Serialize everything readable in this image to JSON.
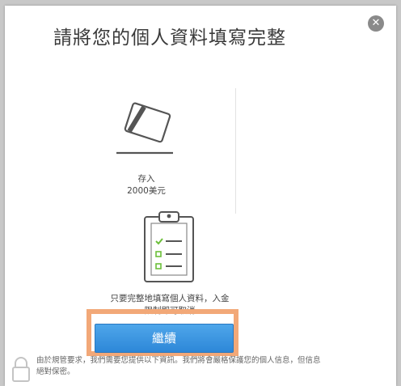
{
  "modal": {
    "title": "請將您的個人資料填寫完整",
    "close_symbol": "✕"
  },
  "deposit": {
    "label": "存入",
    "amount": "2000美元",
    "icon": "credit-card-icon"
  },
  "verification": {
    "icon": "clipboard-checklist-icon",
    "note_line1": "只要完整地填寫個人資料，入金",
    "note_line2": "限制即可取消"
  },
  "actions": {
    "continue_label": "繼續"
  },
  "footer": {
    "icon": "lock-icon",
    "line1": "由於規管要求，我們需要您提供以下資訊。我們將會嚴格保護您的個人信息，但信息",
    "line2": "絕對保密。"
  },
  "colors": {
    "button": "#3595df",
    "highlight": "#f2a878",
    "check": "#6cbf3a"
  }
}
